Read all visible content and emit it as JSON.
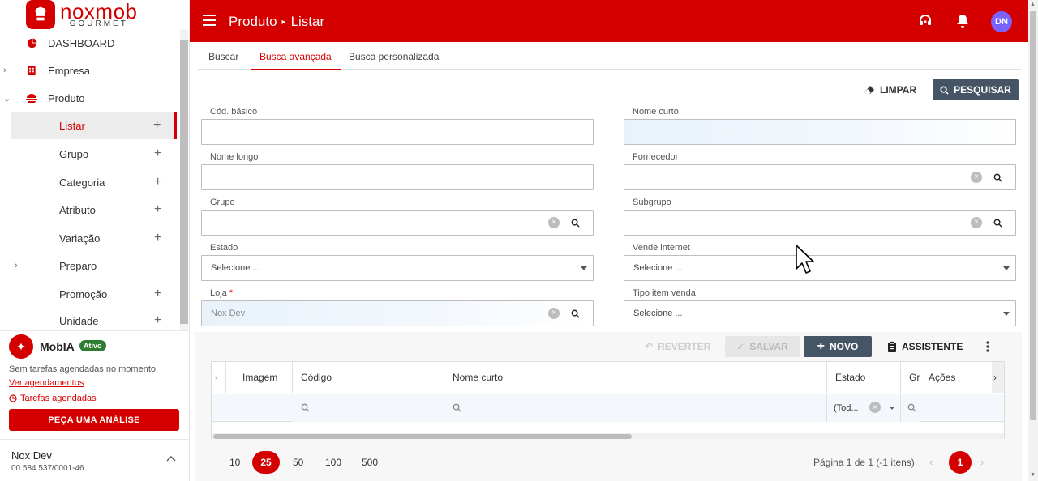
{
  "brand": {
    "name": "noxmob",
    "sub": "GOURMET"
  },
  "sidebar": {
    "items": [
      {
        "label": "DASHBOARD"
      },
      {
        "label": "Empresa"
      },
      {
        "label": "Produto"
      },
      {
        "label": "Listar"
      },
      {
        "label": "Grupo"
      },
      {
        "label": "Categoria"
      },
      {
        "label": "Atributo"
      },
      {
        "label": "Variação"
      },
      {
        "label": "Preparo"
      },
      {
        "label": "Promoção"
      },
      {
        "label": "Unidade"
      }
    ]
  },
  "mobia": {
    "title": "MobIA",
    "badge": "Ativo",
    "text": "Sem tarefas agendadas no momento.",
    "link": "Ver agendamentos",
    "tasks": "Tarefas agendadas",
    "button": "PEÇA UMA ANÁLISE"
  },
  "store": {
    "name": "Nox Dev",
    "cnpj": "00.584.537/0001-46"
  },
  "header": {
    "crumb1": "Produto",
    "crumb2": "Listar",
    "avatar": "DN"
  },
  "tabs": [
    "Buscar",
    "Busca avançada",
    "Busca personalizada"
  ],
  "actions": {
    "limpar": "LIMPAR",
    "pesquisar": "PESQUISAR"
  },
  "form": {
    "cod_basico": {
      "label": "Cód. básico",
      "value": ""
    },
    "nome_curto": {
      "label": "Nome curto",
      "value": ""
    },
    "nome_longo": {
      "label": "Nome longo",
      "value": ""
    },
    "fornecedor": {
      "label": "Fornecedor",
      "value": ""
    },
    "grupo": {
      "label": "Grupo",
      "value": ""
    },
    "subgrupo": {
      "label": "Subgrupo",
      "value": ""
    },
    "estado": {
      "label": "Estado",
      "value": "Selecione ..."
    },
    "vende_internet": {
      "label": "Vende internet",
      "value": "Selecione ..."
    },
    "loja": {
      "label": "Loja",
      "required": "*",
      "value": "Nox Dev"
    },
    "tipo_item": {
      "label": "Tipo item venda",
      "value": "Selecione ..."
    }
  },
  "grid_actions": {
    "reverter": "REVERTER",
    "salvar": "SALVAR",
    "novo": "NOVO",
    "assistente": "ASSISTENTE"
  },
  "grid": {
    "columns": [
      "Imagem",
      "Código",
      "Nome curto",
      "Estado",
      "Gr",
      "Ações"
    ],
    "estado_filter": "(Tod..."
  },
  "pager": {
    "sizes": [
      "10",
      "25",
      "50",
      "100",
      "500"
    ],
    "info": "Página 1 de 1 (-1 itens)",
    "current": "1"
  }
}
